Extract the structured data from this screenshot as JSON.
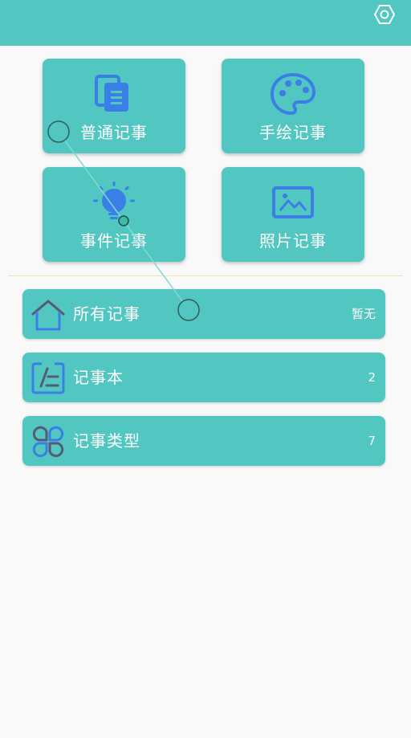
{
  "colors": {
    "accent": "#52c7c1",
    "icon_blue": "#3a7fe6",
    "icon_teal": "#52c7c1",
    "icon_gray": "#555b73",
    "background": "#f9f9f9",
    "divider": "#ece6a8",
    "text": "#ffffff"
  },
  "header": {
    "settings_icon": "hex-gear-icon"
  },
  "tiles": [
    {
      "label": "普通记事",
      "icon": "note-copy-icon"
    },
    {
      "label": "手绘记事",
      "icon": "palette-icon"
    },
    {
      "label": "事件记事",
      "icon": "lightbulb-icon"
    },
    {
      "label": "照片记事",
      "icon": "image-icon"
    }
  ],
  "list": [
    {
      "label": "所有记事",
      "count": "暂无",
      "icon": "home-icon"
    },
    {
      "label": "记事本",
      "count": "2",
      "icon": "notebook-icon"
    },
    {
      "label": "记事类型",
      "count": "7",
      "icon": "clover-icon"
    }
  ]
}
